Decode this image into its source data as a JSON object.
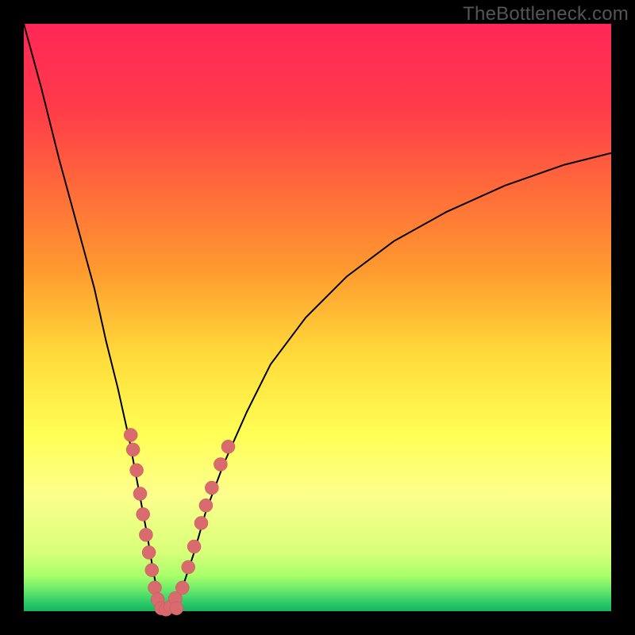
{
  "watermark": "TheBottleneck.com",
  "colors": {
    "frame": "#000000",
    "curve": "#000000",
    "marker_fill": "#d96a6d",
    "marker_stroke": "#cc5558",
    "gradient_stops": [
      {
        "offset": 0.0,
        "color": "#ff2757"
      },
      {
        "offset": 0.14,
        "color": "#ff3a4a"
      },
      {
        "offset": 0.28,
        "color": "#ff6a3a"
      },
      {
        "offset": 0.42,
        "color": "#ff9a2f"
      },
      {
        "offset": 0.56,
        "color": "#ffd93a"
      },
      {
        "offset": 0.7,
        "color": "#ffff55"
      },
      {
        "offset": 0.8,
        "color": "#fdff8c"
      },
      {
        "offset": 0.9,
        "color": "#d8ff7a"
      },
      {
        "offset": 0.94,
        "color": "#a8ff6a"
      },
      {
        "offset": 0.965,
        "color": "#66e86a"
      },
      {
        "offset": 0.985,
        "color": "#2ecb6a"
      },
      {
        "offset": 1.0,
        "color": "#17b45e"
      }
    ]
  },
  "chart_data": {
    "type": "line",
    "title": "",
    "xlabel": "",
    "ylabel": "",
    "xlim": [
      0,
      100
    ],
    "ylim": [
      0,
      100
    ],
    "grid": false,
    "legend": false,
    "series": [
      {
        "name": "bottleneck-curve",
        "x": [
          0,
          3,
          6,
          9,
          12,
          14,
          16,
          18,
          19.5,
          21,
          22,
          23,
          24,
          25,
          27,
          29,
          31,
          34,
          38,
          42,
          48,
          55,
          63,
          72,
          82,
          92,
          100
        ],
        "y": [
          100,
          89,
          77,
          66,
          55,
          46,
          38,
          29,
          21,
          13,
          7,
          2,
          0,
          1,
          4,
          10,
          17,
          25,
          34,
          42,
          50,
          57,
          63,
          68,
          72.5,
          76,
          78
        ]
      }
    ],
    "markers": {
      "name": "highlight-points",
      "points": [
        {
          "x": 18.2,
          "y": 30.0
        },
        {
          "x": 18.6,
          "y": 27.5
        },
        {
          "x": 19.2,
          "y": 24.0
        },
        {
          "x": 19.8,
          "y": 20.0
        },
        {
          "x": 20.3,
          "y": 16.5
        },
        {
          "x": 20.8,
          "y": 13.0
        },
        {
          "x": 21.3,
          "y": 10.0
        },
        {
          "x": 21.8,
          "y": 7.0
        },
        {
          "x": 22.3,
          "y": 4.0
        },
        {
          "x": 22.8,
          "y": 2.0
        },
        {
          "x": 23.4,
          "y": 0.5
        },
        {
          "x": 24.2,
          "y": 0.3
        },
        {
          "x": 25.0,
          "y": 0.8
        },
        {
          "x": 25.8,
          "y": 2.2
        },
        {
          "x": 26.0,
          "y": 0.5
        },
        {
          "x": 27.0,
          "y": 4.0
        },
        {
          "x": 28.0,
          "y": 7.5
        },
        {
          "x": 29.0,
          "y": 11.0
        },
        {
          "x": 30.2,
          "y": 15.0
        },
        {
          "x": 31.0,
          "y": 18.0
        },
        {
          "x": 32.0,
          "y": 21.0
        },
        {
          "x": 33.5,
          "y": 25.0
        },
        {
          "x": 34.8,
          "y": 28.0
        }
      ]
    }
  }
}
